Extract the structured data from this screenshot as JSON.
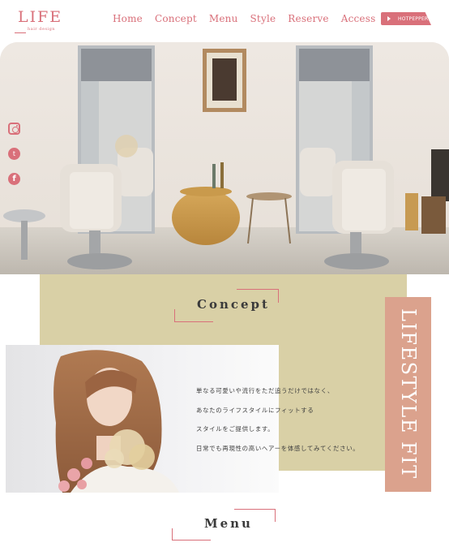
{
  "header": {
    "logo": {
      "main": "LIFE",
      "sub": "hair design"
    },
    "nav": [
      {
        "label": "Home"
      },
      {
        "label": "Concept"
      },
      {
        "label": "Menu"
      },
      {
        "label": "Style"
      },
      {
        "label": "Reserve"
      },
      {
        "label": "Access"
      }
    ],
    "hotpepper_label": "HOTPEPPER"
  },
  "social": {
    "icons": [
      "instagram-icon",
      "twitter-icon",
      "facebook-icon"
    ],
    "twitter_glyph": "t",
    "facebook_glyph": "f"
  },
  "concept": {
    "title": "Concept",
    "lines": [
      "単なる可愛いや流行をただ追うだけではなく、",
      "あなたのライフスタイルにフィットする",
      "スタイルをご提供します。",
      "日常でも再現性の高いヘアーを体感してみてください。"
    ],
    "side_label": "LIFESTYLE FIT"
  },
  "menu": {
    "title": "Menu"
  },
  "colors": {
    "accent": "#d9707a",
    "concept_bg": "#d9d0a6",
    "side_panel": "#dba28d"
  }
}
